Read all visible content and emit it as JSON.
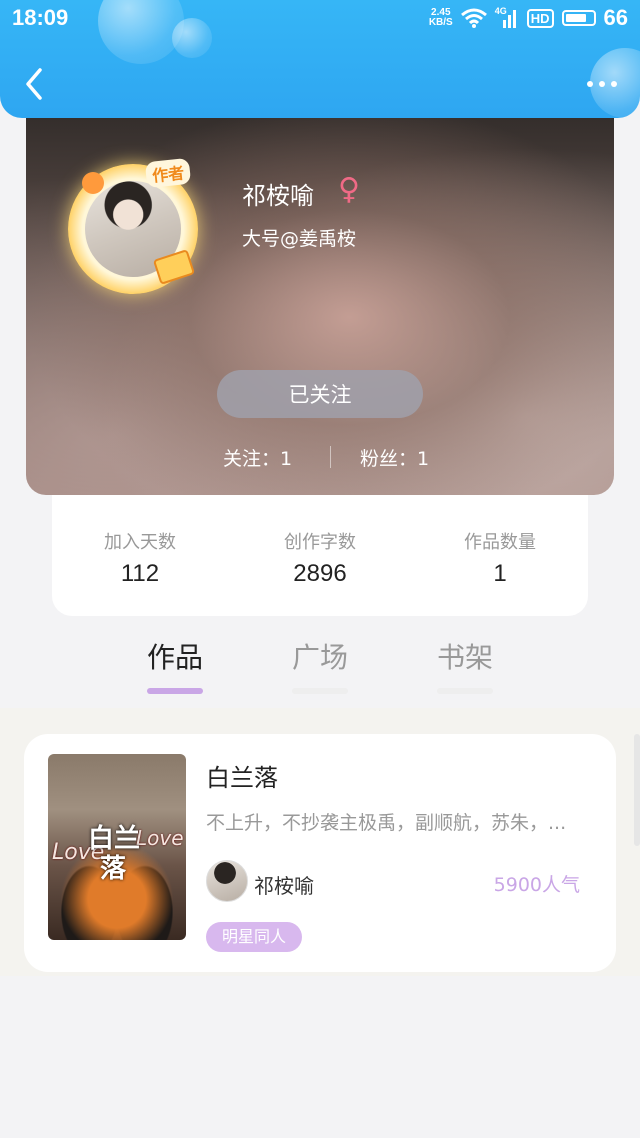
{
  "status_bar": {
    "time": "18:09",
    "net_speed_value": "2.45",
    "net_speed_unit": "KB/S",
    "signal_label": "4G",
    "hd_label": "HD",
    "battery": "66"
  },
  "profile": {
    "name": "祁桉喻",
    "gender_symbol": "♀",
    "sub_account": "大号@姜禹桉",
    "author_tag": "作者",
    "follow_button": "已关注",
    "following": "关注：1",
    "fans": "粉丝：1"
  },
  "stats": [
    {
      "label": "加入天数",
      "value": "112"
    },
    {
      "label": "创作字数",
      "value": "2896"
    },
    {
      "label": "作品数量",
      "value": "1"
    }
  ],
  "tabs": [
    {
      "label": "作品",
      "active": true
    },
    {
      "label": "广场",
      "active": false
    },
    {
      "label": "书架",
      "active": false
    }
  ],
  "works": [
    {
      "title": "白兰落",
      "description": "不上升，不抄袭主极禹，副顺航，苏朱，...",
      "author": "祁桉喻",
      "popularity": "5900人气",
      "tag": "明星同人",
      "cover_title_line1": "白兰",
      "cover_title_line2": "落",
      "cover_love": "Love"
    }
  ],
  "colors": {
    "header_blue": "#36b6f6",
    "accent_purple": "#c9a6e6",
    "gender_pink": "#f06a86"
  }
}
